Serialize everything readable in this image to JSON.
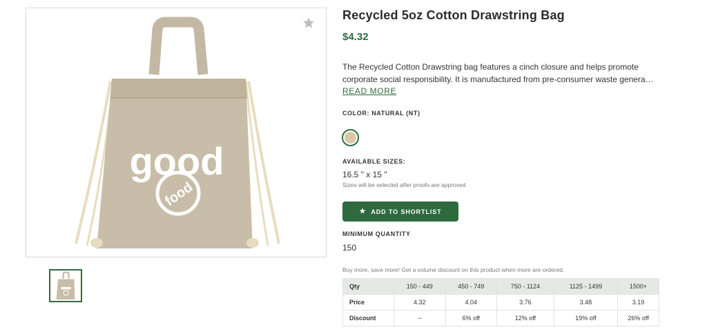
{
  "product": {
    "title": "Recycled 5oz Cotton Drawstring Bag",
    "price": "$4.32",
    "description_line1": "The Recycled Cotton Drawstring bag features a cinch closure and helps promote",
    "description_line2": "corporate social responsibility. It is manufactured from pre-consumer waste genera…",
    "read_more": "READ MORE"
  },
  "image": {
    "logo_text": "good",
    "seal_text": "food"
  },
  "color": {
    "label": "COLOR: NATURAL (NT)",
    "swatch_hex": "#d8c7a5"
  },
  "sizes": {
    "label": "AVAILABLE SIZES:",
    "value": "16.5 \" x 15 \"",
    "note": "Sizes will be selected after proofs are approved"
  },
  "shortlist": {
    "label": "ADD TO SHORTLIST",
    "icon": "star-icon"
  },
  "minimum": {
    "label": "MINIMUM QUANTITY",
    "value": "150"
  },
  "volume_note": "Buy more, save more! Get a volume discount on this product when more are ordered.",
  "pricing_table": {
    "header": [
      "Qty",
      "150 - 449",
      "450 - 749",
      "750 - 1124",
      "1125 - 1499",
      "1500+"
    ],
    "price_row": [
      "Price",
      "4.32",
      "4.04",
      "3.76",
      "3.48",
      "3.19"
    ],
    "discount_row": [
      "Discount",
      "--",
      "6% off",
      "12% off",
      "19% off",
      "26% off"
    ]
  },
  "colors": {
    "accent": "#2e6a3e",
    "table_header_bg": "#e5e9e6",
    "bag": "#c8bda8"
  }
}
